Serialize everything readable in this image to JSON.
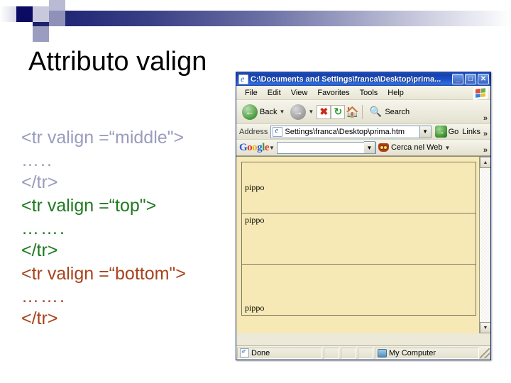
{
  "slide": {
    "title": "Attributo valign",
    "code": [
      {
        "text": "<tr  valign =“middle\">",
        "color_key": "middle"
      },
      {
        "text": "…..",
        "color_key": "middle"
      },
      {
        "text": "</tr>",
        "color_key": "middle"
      },
      {
        "text": "<tr  valign =“top\">",
        "color_key": "top"
      },
      {
        "text": "…….",
        "color_key": "top"
      },
      {
        "text": "</tr>",
        "color_key": "top"
      },
      {
        "text": "<tr  valign =“bottom\">",
        "color_key": "bottom"
      },
      {
        "text": "…….",
        "color_key": "bottom"
      },
      {
        "text": "</tr>",
        "color_key": "bottom"
      }
    ],
    "colors": {
      "middle": "#9a9cbe",
      "top": "#1f7a1f",
      "bottom": "#a8431c",
      "title": "#000000",
      "header_navy": "#0b0b63"
    }
  },
  "browser": {
    "titlebar": {
      "title": "C:\\Documents and Settings\\franca\\Desktop\\prima...",
      "icon": "ie-document-icon",
      "minimize": "_",
      "maximize": "□",
      "close": "✕"
    },
    "menu": [
      {
        "label": "File",
        "accel": "F"
      },
      {
        "label": "Edit",
        "accel": "E"
      },
      {
        "label": "View",
        "accel": "V"
      },
      {
        "label": "Favorites",
        "accel": "a"
      },
      {
        "label": "Tools",
        "accel": "T"
      },
      {
        "label": "Help",
        "accel": "H"
      }
    ],
    "toolbar": {
      "back_label": "Back",
      "search_label": "Search",
      "overflow": "»",
      "icons": [
        "back-arrow-icon",
        "forward-arrow-icon",
        "stop-icon",
        "refresh-icon",
        "home-icon",
        "search-icon"
      ]
    },
    "address": {
      "label": "Address",
      "value": "Settings\\franca\\Desktop\\prima.htm",
      "go_label": "Go",
      "links_label": "Links",
      "overflow": "»"
    },
    "google_toolbar": {
      "logo": [
        "G",
        "o",
        "o",
        "g",
        "l",
        "e"
      ],
      "search_value": "",
      "web_search_label": "Cerca nel Web",
      "overflow": "»"
    },
    "page": {
      "background_color": "#f7e9b5",
      "rows": [
        {
          "text": "pippo",
          "valign": "middle"
        },
        {
          "text": "pippo",
          "valign": "top"
        },
        {
          "text": "pippo",
          "valign": "bottom"
        }
      ]
    },
    "scrollbar": {
      "up": "▲",
      "down": "▼"
    },
    "statusbar": {
      "status": "Done",
      "zone": "My Computer"
    }
  }
}
